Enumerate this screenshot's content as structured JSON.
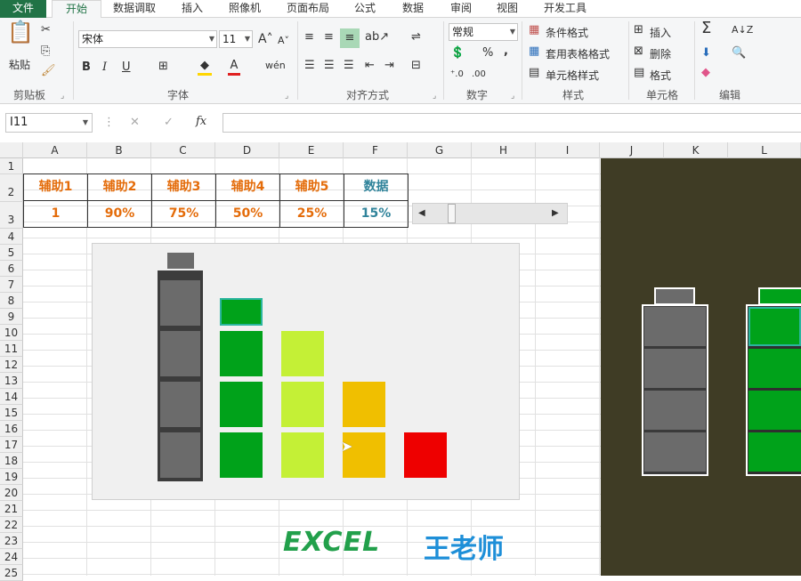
{
  "tabs": [
    "文件",
    "开始",
    "数据调取",
    "插入",
    "照像机",
    "页面布局",
    "公式",
    "数据",
    "审阅",
    "视图",
    "开发工具"
  ],
  "clipboard": {
    "paste": "粘贴",
    "group": "剪贴板"
  },
  "font": {
    "name": "宋体",
    "size": "11",
    "bold": "B",
    "italic": "I",
    "underline": "U",
    "group": "字体"
  },
  "align": {
    "group": "对齐方式"
  },
  "number": {
    "format": "常规",
    "percent": "%",
    "comma": ",",
    "group": "数字"
  },
  "styles": {
    "cond": "条件格式",
    "table": "套用表格格式",
    "cell": "单元格样式",
    "group": "样式"
  },
  "cells": {
    "insert": "插入",
    "delete": "删除",
    "format": "格式",
    "group": "单元格"
  },
  "edit": {
    "group": "编辑"
  },
  "formula_bar": {
    "name_box": "I11",
    "fx": "fx",
    "cancel": "✕",
    "confirm": "✓",
    "value": ""
  },
  "columns": [
    "A",
    "B",
    "C",
    "D",
    "E",
    "F",
    "G",
    "H",
    "I",
    "J",
    "K",
    "L"
  ],
  "rows": [
    "1",
    "2",
    "3",
    "4",
    "5",
    "6",
    "7",
    "8",
    "9",
    "10",
    "11",
    "12",
    "13",
    "14",
    "15",
    "16",
    "17",
    "18",
    "19",
    "20",
    "21",
    "22",
    "23",
    "24",
    "25"
  ],
  "table": {
    "headers": [
      "辅助1",
      "辅助2",
      "辅助3",
      "辅助4",
      "辅助5",
      "数据"
    ],
    "values": [
      "1",
      "90%",
      "75%",
      "50%",
      "25%",
      "15%"
    ]
  },
  "scrollbar": {
    "value": 0.15
  },
  "chart_data": {
    "type": "bar",
    "categories": [
      "辅助1",
      "辅助2",
      "辅助3",
      "辅助4",
      "辅助5"
    ],
    "values": [
      1,
      0.9,
      0.75,
      0.5,
      0.25
    ],
    "colors": [
      "#6b6b6b",
      "#00a21a",
      "#c4f036",
      "#f0bf00",
      "#ee0000"
    ],
    "ylim": [
      0,
      1
    ]
  },
  "branding": {
    "excel": "EXCEL",
    "teacher": "王老师"
  },
  "colors": {
    "excel_green": "#217346",
    "orange": "#e46c0a",
    "teal": "#31849b",
    "dark_panel": "#3f3c25"
  }
}
